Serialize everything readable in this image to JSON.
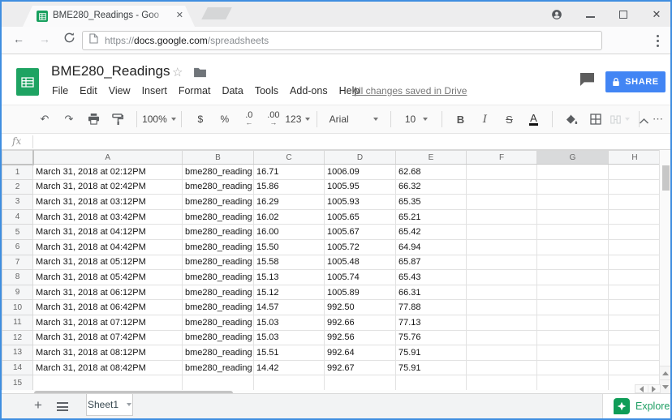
{
  "browser": {
    "tab": {
      "title": "BME280_Readings - Goo"
    },
    "address": {
      "scheme": "https://",
      "domain": "docs.google.com",
      "path": "/spreadsheets"
    }
  },
  "header": {
    "title": "BME280_Readings",
    "menus": [
      "File",
      "Edit",
      "View",
      "Insert",
      "Format",
      "Data",
      "Tools",
      "Add-ons",
      "Help"
    ],
    "save_status": "All changes saved in Drive",
    "share_label": "SHARE"
  },
  "toolbar": {
    "zoom": "100%",
    "currency": "$",
    "percent": "%",
    "decimal_decrease": ".0",
    "decimal_increase": ".00",
    "number_format": "123",
    "font_family": "Arial",
    "font_size": "10",
    "bold": "B",
    "italic": "I",
    "strikethrough": "S",
    "text_color": "A",
    "more": "⋯"
  },
  "formula_bar": {
    "label": "fx"
  },
  "grid": {
    "column_headers": [
      "A",
      "B",
      "C",
      "D",
      "E",
      "F",
      "G",
      "H"
    ],
    "highlighted_column": "G",
    "rows": [
      {
        "n": "1",
        "a": "March 31, 2018 at 02:12PM",
        "b": "bme280_reading",
        "c": "16.71",
        "d": "1006.09",
        "e": "62.68"
      },
      {
        "n": "2",
        "a": "March 31, 2018 at 02:42PM",
        "b": "bme280_reading",
        "c": "15.86",
        "d": "1005.95",
        "e": "66.32"
      },
      {
        "n": "3",
        "a": "March 31, 2018 at 03:12PM",
        "b": "bme280_reading",
        "c": "16.29",
        "d": "1005.93",
        "e": "65.35"
      },
      {
        "n": "4",
        "a": "March 31, 2018 at 03:42PM",
        "b": "bme280_reading",
        "c": "16.02",
        "d": "1005.65",
        "e": "65.21"
      },
      {
        "n": "5",
        "a": "March 31, 2018 at 04:12PM",
        "b": "bme280_reading",
        "c": "16.00",
        "d": "1005.67",
        "e": "65.42"
      },
      {
        "n": "6",
        "a": "March 31, 2018 at 04:42PM",
        "b": "bme280_reading",
        "c": "15.50",
        "d": "1005.72",
        "e": "64.94"
      },
      {
        "n": "7",
        "a": "March 31, 2018 at 05:12PM",
        "b": "bme280_reading",
        "c": "15.58",
        "d": "1005.48",
        "e": "65.87"
      },
      {
        "n": "8",
        "a": "March 31, 2018 at 05:42PM",
        "b": "bme280_reading",
        "c": "15.13",
        "d": "1005.74",
        "e": "65.43"
      },
      {
        "n": "9",
        "a": "March 31, 2018 at 06:12PM",
        "b": "bme280_reading",
        "c": "15.12",
        "d": "1005.89",
        "e": "66.31"
      },
      {
        "n": "10",
        "a": "March 31, 2018 at 06:42PM",
        "b": "bme280_reading",
        "c": "14.57",
        "d": "992.50",
        "e": "77.88"
      },
      {
        "n": "11",
        "a": "March 31, 2018 at 07:12PM",
        "b": "bme280_reading",
        "c": "15.03",
        "d": "992.66",
        "e": "77.13"
      },
      {
        "n": "12",
        "a": "March 31, 2018 at 07:42PM",
        "b": "bme280_reading",
        "c": "15.03",
        "d": "992.56",
        "e": "75.76"
      },
      {
        "n": "13",
        "a": "March 31, 2018 at 08:12PM",
        "b": "bme280_reading",
        "c": "15.51",
        "d": "992.64",
        "e": "75.91"
      },
      {
        "n": "14",
        "a": "March 31, 2018 at 08:42PM",
        "b": "bme280_reading",
        "c": "14.42",
        "d": "992.67",
        "e": "75.91"
      },
      {
        "n": "15",
        "a": "",
        "b": "",
        "c": "",
        "d": "",
        "e": ""
      }
    ]
  },
  "footer": {
    "sheet_tab": "Sheet1",
    "explore": "Explore"
  },
  "colors": {
    "share_blue": "#4285f4",
    "sheets_green": "#0f9d58",
    "window_border": "#3f8ee0"
  }
}
